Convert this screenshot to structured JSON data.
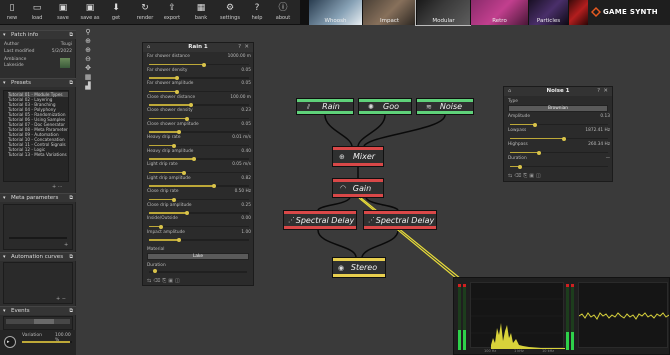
{
  "toolbar": {
    "buttons": [
      {
        "label": "new",
        "icon": "file-icon"
      },
      {
        "label": "load",
        "icon": "folder-icon"
      },
      {
        "label": "save",
        "icon": "save-icon"
      },
      {
        "label": "save as",
        "icon": "save-as-icon"
      },
      {
        "label": "get",
        "icon": "download-icon"
      },
      {
        "label": "render",
        "icon": "render-icon"
      },
      {
        "label": "export",
        "icon": "export-icon"
      },
      {
        "label": "bank",
        "icon": "bank-icon"
      },
      {
        "label": "settings",
        "icon": "gear-icon"
      },
      {
        "label": "help",
        "icon": "help-icon"
      },
      {
        "label": "about",
        "icon": "info-icon"
      }
    ],
    "preset_tabs": [
      "Whoosh",
      "Impact",
      "Modular",
      "Retro",
      "Particles"
    ],
    "active_tab": "Modular",
    "brand": "GAME SYNTH"
  },
  "sidebar": {
    "patch_info": {
      "title": "Patch info",
      "author_label": "Author",
      "author_value": "Tsugi",
      "modified_label": "Last modified",
      "modified_value": "5/2/2022",
      "notes": [
        "Ambiance",
        "Lakeside"
      ]
    },
    "presets": {
      "title": "Presets",
      "items": [
        "Tutorial 01 - Module Types",
        "Tutorial 02 - Layering",
        "Tutorial 03 - Branching",
        "Tutorial 04 - Polyphony",
        "Tutorial 05 - Randomization",
        "Tutorial 06 - Using Samples",
        "Tutorial 07 - Doc Generator",
        "Tutorial 08 - Meta Parameters",
        "Tutorial 09 - Automation",
        "Tutorial 10 - Concatenation",
        "Tutorial 11 - Control Signals",
        "Tutorial 12 - Logic",
        "Tutorial 13 - Meta Variations"
      ]
    },
    "meta_parameters": {
      "title": "Meta parameters"
    },
    "automation_curves": {
      "title": "Automation curves"
    },
    "events": {
      "title": "Events"
    },
    "variation": {
      "label": "Variation",
      "value": "100.00 %"
    }
  },
  "rain_panel": {
    "title": "Rain 1",
    "params": [
      {
        "name": "Far shower distance",
        "value": "1000.00 m",
        "pos": 0.55
      },
      {
        "name": "Far shower density",
        "value": "0.05",
        "pos": 0.28
      },
      {
        "name": "Far shower amplitude",
        "value": "0.05",
        "pos": 0.28
      },
      {
        "name": "Close shower distance",
        "value": "100.00 m",
        "pos": 0.42
      },
      {
        "name": "Close shower density",
        "value": "0.23",
        "pos": 0.38
      },
      {
        "name": "Close shower amplitude",
        "value": "0.05",
        "pos": 0.3
      },
      {
        "name": "Heavy drip rate",
        "value": "0.01 m/s",
        "pos": 0.25
      },
      {
        "name": "Heavy drip amplitude",
        "value": "0.40",
        "pos": 0.45
      },
      {
        "name": "Light drip rate",
        "value": "0.05 m/s",
        "pos": 0.35
      },
      {
        "name": "Light drip amplitude",
        "value": "0.82",
        "pos": 0.65
      },
      {
        "name": "Close drip rate",
        "value": "0.50 Hz",
        "pos": 0.25
      },
      {
        "name": "Close drip amplitude",
        "value": "0.25",
        "pos": 0.38
      },
      {
        "name": "Inside/Outside",
        "value": "0.00",
        "pos": 0.12
      },
      {
        "name": "Impact amplitude",
        "value": "1.00",
        "pos": 0.3
      }
    ],
    "material_label": "Material",
    "material_value": "Lake",
    "duration_label": "Duration"
  },
  "noise_panel": {
    "title": "Noise 1",
    "type_label": "Type",
    "type_value": "Brownian",
    "params": [
      {
        "name": "Amplitude",
        "value": "0.13",
        "pos": 0.25
      },
      {
        "name": "Lowpass",
        "value": "1872.41 Hz",
        "pos": 0.55
      },
      {
        "name": "Highpass",
        "value": "260.34 Hz",
        "pos": 0.3
      },
      {
        "name": "Duration",
        "value": "—",
        "pos": 0.1
      }
    ]
  },
  "nodes": {
    "rain": "Rain",
    "goo": "Goo",
    "noise": "Noise",
    "mixer": "Mixer",
    "gain": "Gain",
    "delay1": "Spectral Delay",
    "delay2": "Spectral Delay",
    "stereo": "Stereo"
  },
  "scope": {
    "freq_labels": [
      "100 Hz",
      "1 kHz",
      "10 kHz"
    ]
  }
}
